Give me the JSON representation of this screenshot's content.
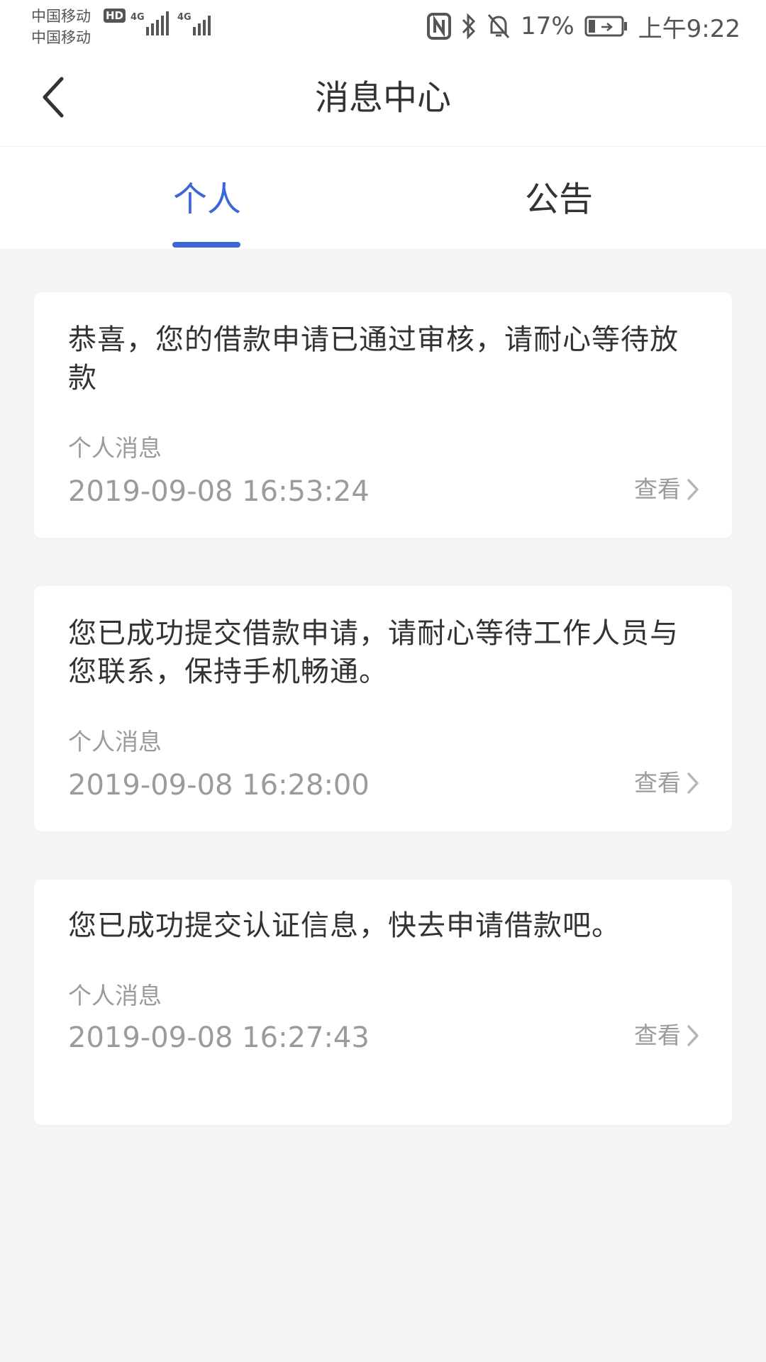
{
  "status_bar": {
    "carrier_1": "中国移动",
    "carrier_2": "中国移动",
    "hd_badge": "HD",
    "network_1": "4G",
    "network_2": "4G",
    "battery_percent": "17%",
    "time": "上午9:22"
  },
  "nav": {
    "title": "消息中心"
  },
  "tabs": [
    {
      "label": "个人",
      "active": true
    },
    {
      "label": "公告",
      "active": false
    }
  ],
  "messages": [
    {
      "text": "恭喜，您的借款申请已通过审核，请耐心等待放款",
      "category": "个人消息",
      "time": "2019-09-08 16:53:24",
      "action": "查看"
    },
    {
      "text": "您已成功提交借款申请，请耐心等待工作人员与您联系，保持手机畅通。",
      "category": "个人消息",
      "time": "2019-09-08 16:28:00",
      "action": "查看"
    },
    {
      "text": "您已成功提交认证信息，快去申请借款吧。",
      "category": "个人消息",
      "time": "2019-09-08 16:27:43",
      "action": "查看"
    }
  ],
  "colors": {
    "accent": "#3a66d8",
    "background": "#f5f5f5",
    "primary_text": "#333333",
    "secondary_text": "#9b9b9b"
  },
  "icons": [
    "back-arrow-icon",
    "nfc-icon",
    "bluetooth-icon",
    "mute-bell-icon",
    "battery-icon",
    "signal-icon",
    "chevron-right-icon"
  ]
}
